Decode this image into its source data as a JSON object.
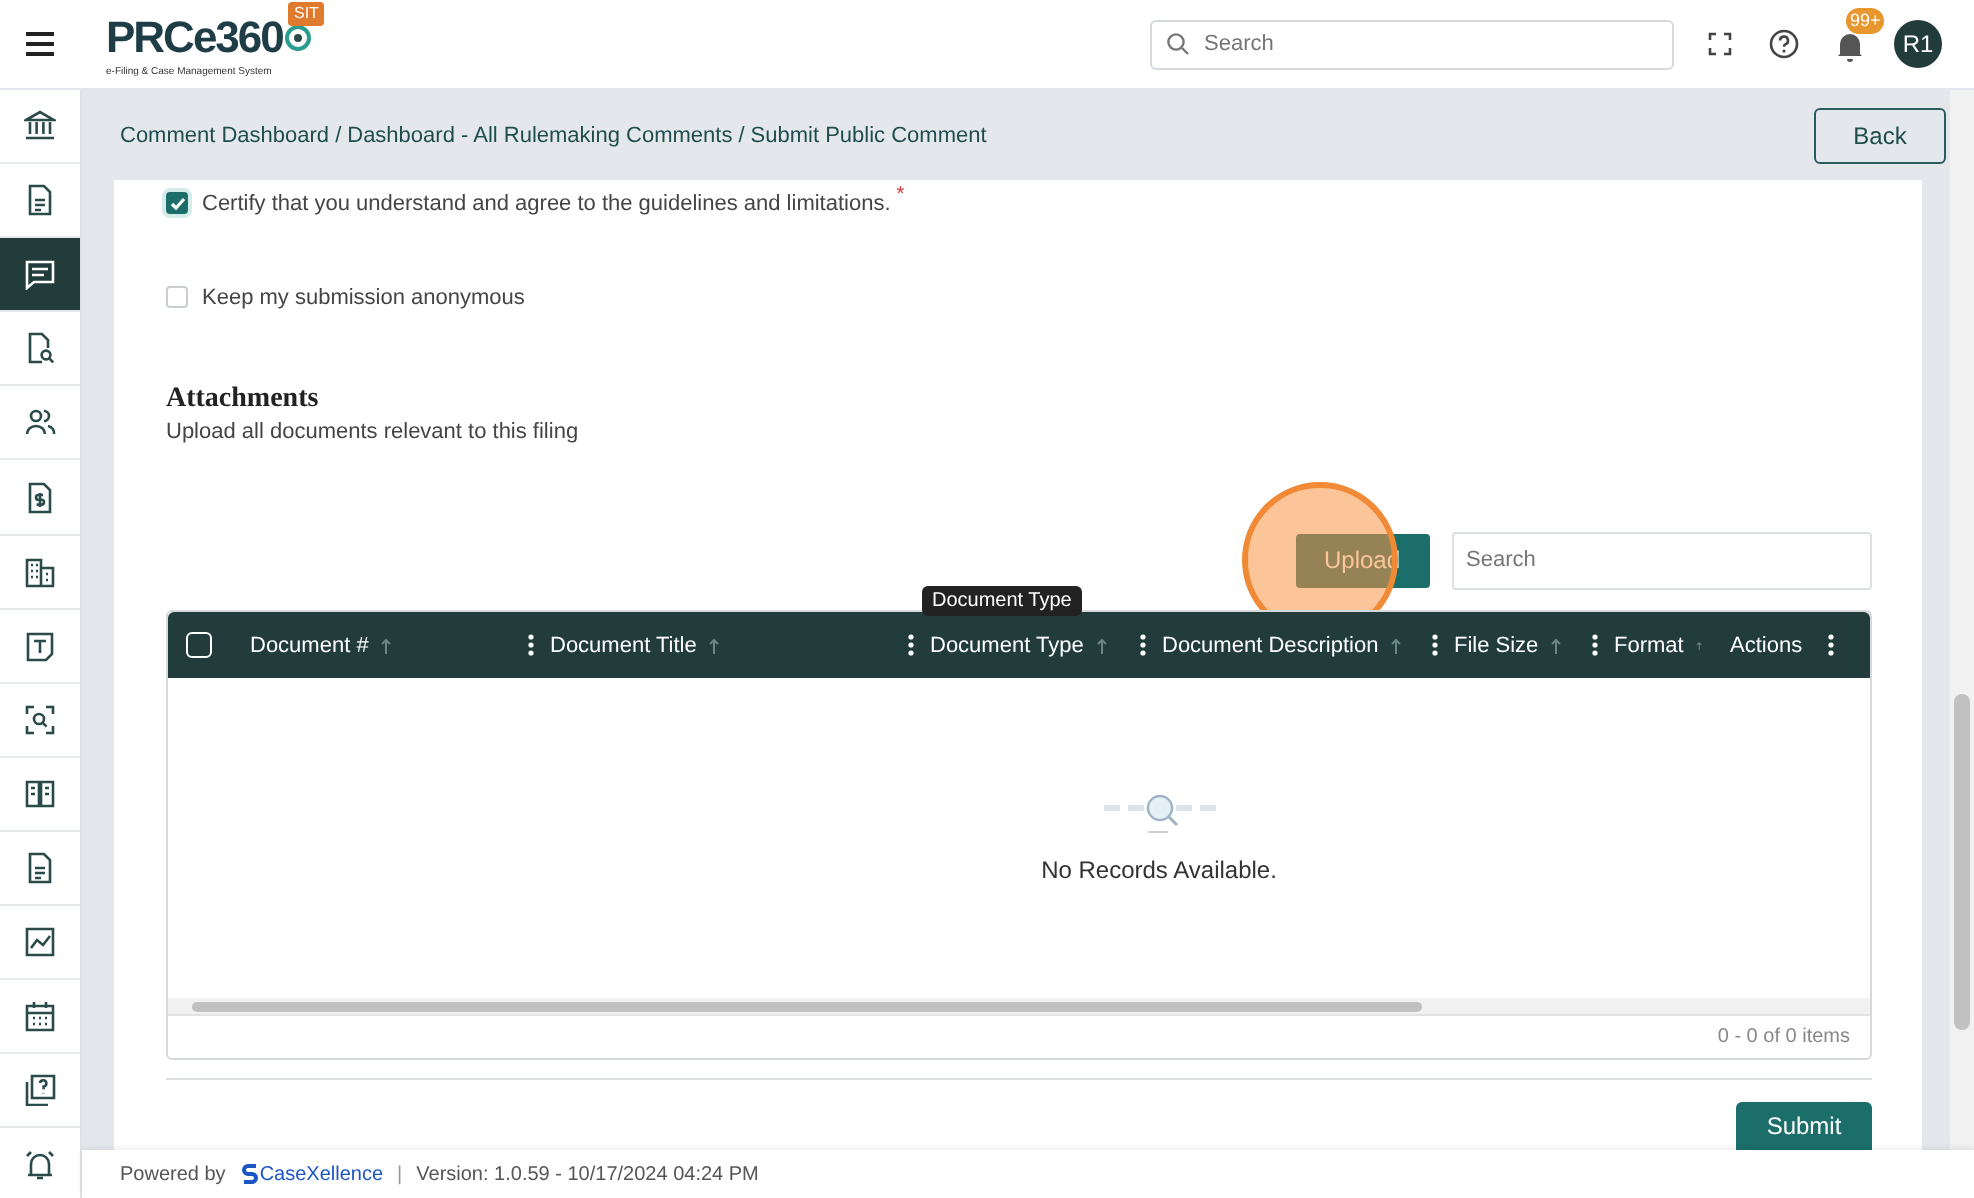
{
  "header": {
    "logo": "PRCe360",
    "logo_subtitle": "e-Filing & Case Management System",
    "env_badge": "SIT",
    "search": {
      "placeholder": "Search"
    },
    "notification_count": "99+",
    "avatar": "R1"
  },
  "sidebar": {
    "items": [
      {
        "selected": false
      },
      {
        "selected": false
      },
      {
        "selected": true
      },
      {
        "selected": false
      },
      {
        "selected": false
      },
      {
        "selected": false
      },
      {
        "selected": false
      },
      {
        "selected": false
      },
      {
        "selected": false
      },
      {
        "selected": false
      },
      {
        "selected": false
      },
      {
        "selected": false
      },
      {
        "selected": false
      },
      {
        "selected": false
      },
      {
        "selected": false
      }
    ]
  },
  "breadcrumb": {
    "items": [
      "Comment Dashboard",
      "Dashboard - All Rulemaking Comments",
      "Submit Public Comment"
    ],
    "separator": "/"
  },
  "back_button": "Back",
  "checkboxes": [
    {
      "label": "Certify that you understand and agree to the guidelines and limitations.",
      "required_mark": "*",
      "checked": true
    },
    {
      "label": "Keep my submission anonymous",
      "checked": false
    }
  ],
  "attachments": {
    "title": "Attachments",
    "subtitle": "Upload all documents relevant to this filing",
    "upload_button": "Upload",
    "search": {
      "placeholder": "Search"
    },
    "tooltip": "Document Type",
    "select_all_checked": false,
    "columns": [
      {
        "label": "Document #",
        "sortable": true,
        "menu": true
      },
      {
        "label": "Document Title",
        "sortable": true,
        "menu": true
      },
      {
        "label": "Document Type",
        "sortable": true,
        "menu": true
      },
      {
        "label": "Document Description",
        "sortable": true,
        "menu": true
      },
      {
        "label": "File Size",
        "sortable": true,
        "menu": true
      },
      {
        "label": "Format",
        "sortable": true,
        "menu": false
      },
      {
        "label": "Actions",
        "sortable": false,
        "menu": true
      }
    ],
    "empty_message": "No Records Available.",
    "pager": "0 - 0 of 0 items"
  },
  "submit_button": "Submit",
  "footer": {
    "powered_by": "Powered by",
    "brand": "CaseXellence",
    "separator": "|",
    "version": "Version: 1.0.59 - 10/17/2024 04:24 PM"
  }
}
